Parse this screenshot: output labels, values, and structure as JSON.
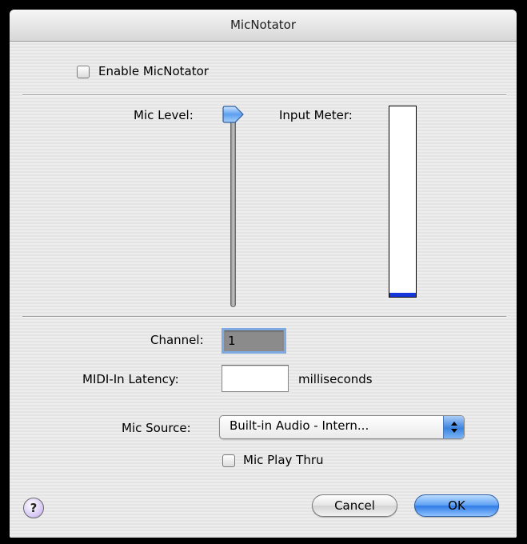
{
  "window": {
    "title": "MicNotator"
  },
  "enable": {
    "label": "Enable MicNotator",
    "checked": false
  },
  "levels": {
    "mic_level_label": "Mic Level:",
    "input_meter_label": "Input Meter:",
    "mic_level_value": 1.0,
    "input_meter_value": 0.02,
    "meter_color": "#1536d8"
  },
  "settings": {
    "channel_label": "Channel:",
    "channel_value": "1",
    "latency_label": "MIDI-In Latency:",
    "latency_value": "",
    "latency_unit": "milliseconds",
    "mic_source_label": "Mic Source:",
    "mic_source_value": "Built-in Audio - Intern...",
    "play_thru_label": "Mic Play Thru",
    "play_thru_checked": false
  },
  "buttons": {
    "help": "?",
    "cancel": "Cancel",
    "ok": "OK"
  },
  "icons": {
    "help": "help-icon",
    "slider_thumb": "slider-thumb-icon",
    "popup_arrows": "up-down-arrows-icon"
  }
}
